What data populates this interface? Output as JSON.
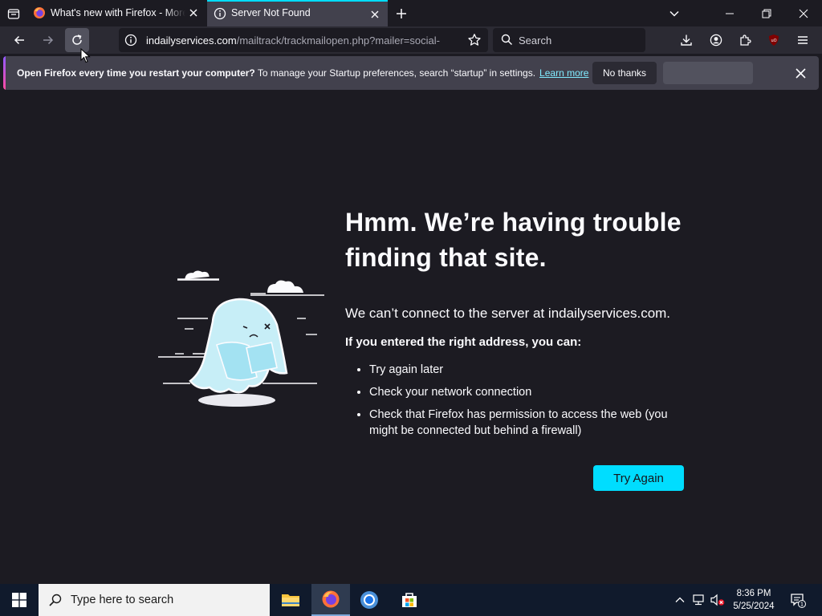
{
  "tabs": [
    {
      "title": "What's new with Firefox - More privacy",
      "icon": "firefox-icon",
      "active": false
    },
    {
      "title": "Server Not Found",
      "icon": "info-icon",
      "active": true
    }
  ],
  "toolbar": {
    "url_host": "indailyservices.com",
    "url_path": "/mailtrack/trackmailopen.php?mailer=social-",
    "search_placeholder": "Search"
  },
  "notification": {
    "bold": "Open Firefox every time you restart your computer?",
    "text": "To manage your Startup preferences, search “startup” in settings.",
    "learn_more": "Learn more",
    "no_thanks": "No thanks"
  },
  "error_page": {
    "title": "Hmm. We’re having trouble finding that site.",
    "message": "We can’t connect to the server at indailyservices.com.",
    "subheading": "If you entered the right address, you can:",
    "suggestions": [
      "Try again later",
      "Check your network connection",
      "Check that Firefox has permission to access the web (you might be connected but behind a firewall)"
    ],
    "try_again": "Try Again"
  },
  "taskbar": {
    "search_placeholder": "Type here to search",
    "time": "8:36 PM",
    "date": "5/25/2024",
    "notification_count": "1"
  },
  "colors": {
    "accent": "#00ddff",
    "background": "#1c1b22",
    "toolbar": "#2b2a33"
  }
}
